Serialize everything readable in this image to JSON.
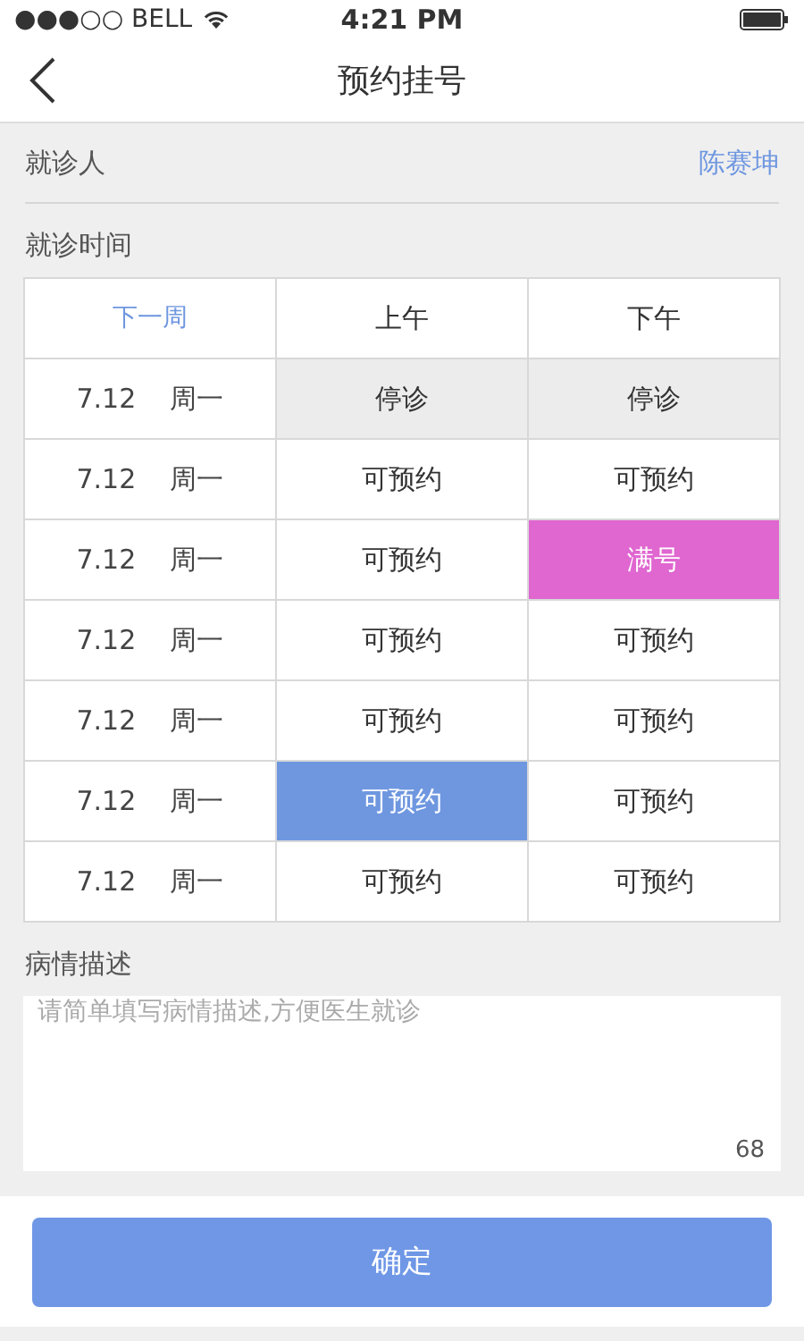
{
  "status_bar": {
    "carrier": "●●●○○ BELL",
    "time": "4:21 PM"
  },
  "nav": {
    "title": "预约挂号"
  },
  "patient": {
    "label": "就诊人",
    "value": "陈赛坤"
  },
  "schedule": {
    "label": "就诊时间",
    "next_week": "下一周",
    "columns": [
      "上午",
      "下午"
    ],
    "rows": [
      {
        "date": "7.12",
        "weekday": "周一",
        "slots": [
          {
            "text": "停诊",
            "kind": "closed",
            "selected": false
          },
          {
            "text": "停诊",
            "kind": "closed",
            "selected": false
          }
        ]
      },
      {
        "date": "7.12",
        "weekday": "周一",
        "slots": [
          {
            "text": "可预约",
            "kind": "open",
            "selected": false
          },
          {
            "text": "可预约",
            "kind": "open",
            "selected": false
          }
        ]
      },
      {
        "date": "7.12",
        "weekday": "周一",
        "slots": [
          {
            "text": "可预约",
            "kind": "open",
            "selected": false
          },
          {
            "text": "满号",
            "kind": "full",
            "selected": false
          }
        ]
      },
      {
        "date": "7.12",
        "weekday": "周一",
        "slots": [
          {
            "text": "可预约",
            "kind": "open",
            "selected": false
          },
          {
            "text": "可预约",
            "kind": "open",
            "selected": false
          }
        ]
      },
      {
        "date": "7.12",
        "weekday": "周一",
        "slots": [
          {
            "text": "可预约",
            "kind": "open",
            "selected": false
          },
          {
            "text": "可预约",
            "kind": "open",
            "selected": false
          }
        ]
      },
      {
        "date": "7.12",
        "weekday": "周一",
        "slots": [
          {
            "text": "可预约",
            "kind": "open",
            "selected": true
          },
          {
            "text": "可预约",
            "kind": "open",
            "selected": false
          }
        ]
      },
      {
        "date": "7.12",
        "weekday": "周一",
        "slots": [
          {
            "text": "可预约",
            "kind": "open",
            "selected": false
          },
          {
            "text": "可预约",
            "kind": "open",
            "selected": false
          }
        ]
      }
    ]
  },
  "description": {
    "label": "病情描述",
    "placeholder": "请简单填写病情描述,方便医生就诊",
    "counter": "68"
  },
  "confirm_button": "确定"
}
